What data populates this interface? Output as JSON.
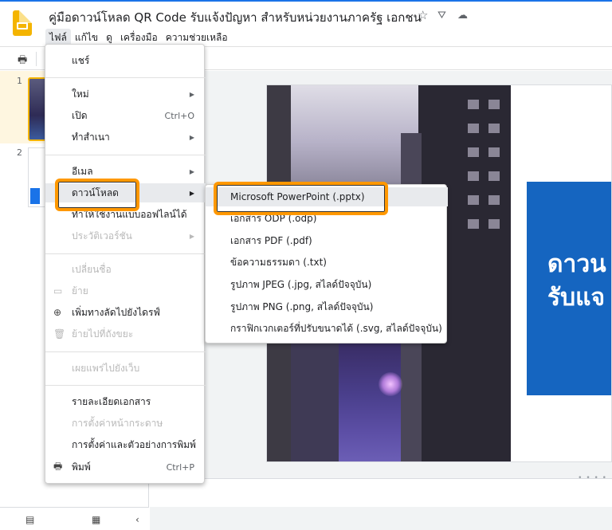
{
  "app": {
    "title": "คู่มือดาวน์โหลด QR Code รับแจ้งปัญหา สำหรับหน่วยงานภาครัฐ เอกชน",
    "title_icons": [
      "star-icon",
      "move-to-drive-icon",
      "cloud-status-icon"
    ]
  },
  "menubar": {
    "items": [
      "ไฟล์",
      "แก้ไข",
      "ดู",
      "เครื่องมือ",
      "ความช่วยเหลือ"
    ]
  },
  "filmstrip": {
    "slide_numbers": [
      "1",
      "2"
    ]
  },
  "file_menu": {
    "items": [
      {
        "label": "แชร์",
        "shortcut": "",
        "submenu": false,
        "disabled": false
      },
      {
        "label": "ใหม่",
        "shortcut": "",
        "submenu": true,
        "disabled": false
      },
      {
        "label": "เปิด",
        "shortcut": "Ctrl+O",
        "submenu": false,
        "disabled": false
      },
      {
        "label": "ทำสำเนา",
        "shortcut": "",
        "submenu": true,
        "disabled": false
      },
      {
        "label": "อีเมล",
        "shortcut": "",
        "submenu": true,
        "disabled": false
      },
      {
        "label": "ดาวน์โหลด",
        "shortcut": "",
        "submenu": true,
        "disabled": false,
        "highlighted": true
      },
      {
        "label": "ทำให้ใช้งานแบบออฟไลน์ได้",
        "shortcut": "",
        "submenu": false,
        "disabled": false
      },
      {
        "label": "ประวัติเวอร์ชัน",
        "shortcut": "",
        "submenu": true,
        "disabled": true
      },
      {
        "label": "เปลี่ยนชื่อ",
        "shortcut": "",
        "submenu": false,
        "disabled": true
      },
      {
        "label": "ย้าย",
        "shortcut": "",
        "submenu": false,
        "disabled": true,
        "icon": "folder-icon"
      },
      {
        "label": "เพิ่มทางลัดไปยังไดรฟ์",
        "shortcut": "",
        "submenu": false,
        "disabled": false,
        "icon": "add-to-drive-icon"
      },
      {
        "label": "ย้ายไปที่ถังขยะ",
        "shortcut": "",
        "submenu": false,
        "disabled": true,
        "icon": "trash-icon"
      },
      {
        "label": "เผยแพร่ไปยังเว็บ",
        "shortcut": "",
        "submenu": false,
        "disabled": true
      },
      {
        "label": "รายละเอียดเอกสาร",
        "shortcut": "",
        "submenu": false,
        "disabled": false
      },
      {
        "label": "การตั้งค่าหน้ากระดาษ",
        "shortcut": "",
        "submenu": false,
        "disabled": true
      },
      {
        "label": "การตั้งค่าและตัวอย่างการพิมพ์",
        "shortcut": "",
        "submenu": false,
        "disabled": false
      },
      {
        "label": "พิมพ์",
        "shortcut": "Ctrl+P",
        "submenu": false,
        "disabled": false,
        "icon": "print-icon"
      }
    ]
  },
  "download_submenu": {
    "items": [
      "Microsoft PowerPoint (.pptx)",
      "เอกสาร ODP (.odp)",
      "เอกสาร PDF (.pdf)",
      "ข้อความธรรมดา (.txt)",
      "รูปภาพ JPEG (.jpg, สไลด์ปัจจุบัน)",
      "รูปภาพ PNG (.png, สไลด์ปัจจุบัน)",
      "กราฟิกเวกเตอร์ที่ปรับขนาดได้ (.svg, สไลด์ปัจจุบัน)"
    ]
  },
  "slide": {
    "heading_lines": [
      "ดาวน",
      "รับแจ"
    ]
  },
  "colors": {
    "highlight_outline": "#ff9800",
    "slide_blue_box": "#1565c0",
    "accent": "#1a73e8"
  }
}
